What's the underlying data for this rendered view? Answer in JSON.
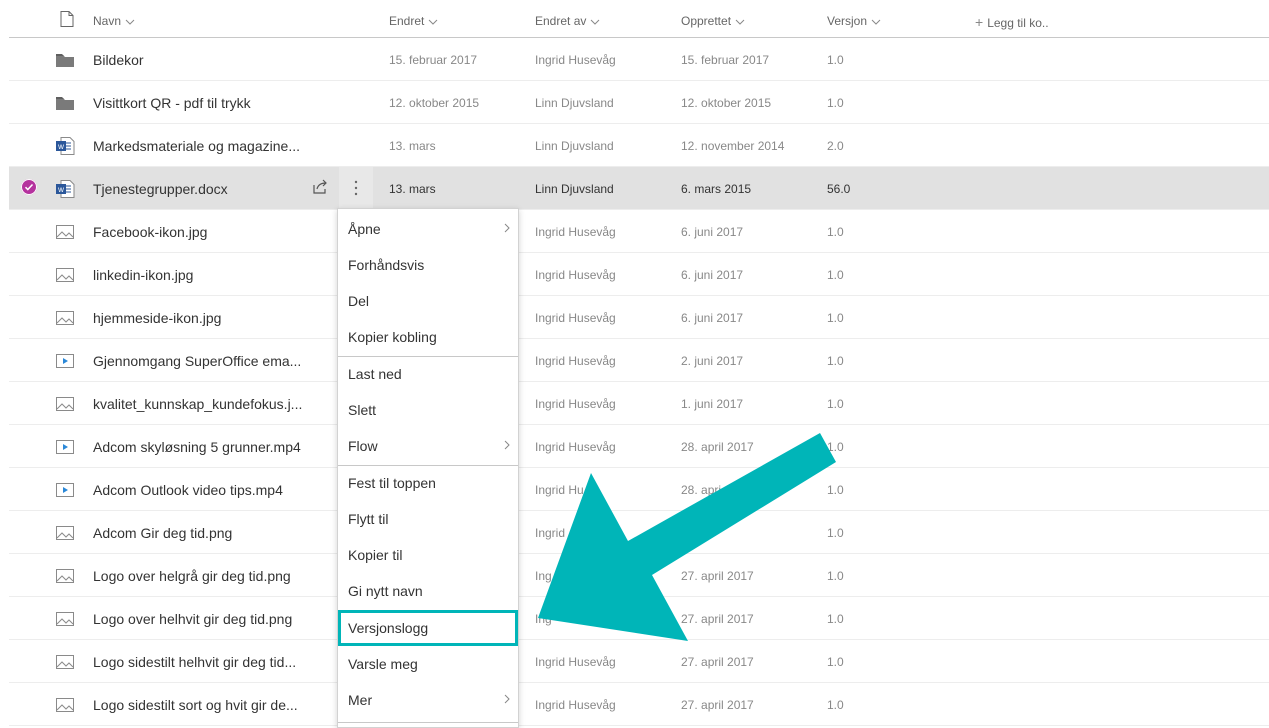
{
  "columns": {
    "name": "Navn",
    "modified": "Endret",
    "modified_by": "Endret av",
    "created": "Opprettet",
    "version": "Versjon",
    "add_column": "Legg til ko.."
  },
  "files": [
    {
      "icon": "folder-icon",
      "name": "Bildekor",
      "modified": "15. februar 2017",
      "modified_by": "Ingrid Husevåg",
      "created": "15. februar 2017",
      "version": "1.0"
    },
    {
      "icon": "folder-icon",
      "name": "Visittkort QR - pdf til trykk",
      "modified": "12. oktober 2015",
      "modified_by": "Linn Djuvsland",
      "created": "12. oktober 2015",
      "version": "1.0"
    },
    {
      "icon": "word-doc-icon",
      "name": "Markedsmateriale og magazine...",
      "modified": "13. mars",
      "modified_by": "Linn Djuvsland",
      "created": "12. november 2014",
      "version": "2.0"
    },
    {
      "icon": "word-doc-icon",
      "name": "Tjenestegrupper.docx",
      "modified": "13. mars",
      "modified_by": "Linn Djuvsland",
      "created": "6. mars 2015",
      "version": "56.0",
      "selected": true
    },
    {
      "icon": "image-icon",
      "name": "Facebook-ikon.jpg",
      "modified": "",
      "modified_by": "Ingrid Husevåg",
      "created": "6. juni 2017",
      "version": "1.0"
    },
    {
      "icon": "image-icon",
      "name": "linkedin-ikon.jpg",
      "modified": "",
      "modified_by": "Ingrid Husevåg",
      "created": "6. juni 2017",
      "version": "1.0"
    },
    {
      "icon": "image-icon",
      "name": "hjemmeside-ikon.jpg",
      "modified": "",
      "modified_by": "Ingrid Husevåg",
      "created": "6. juni 2017",
      "version": "1.0"
    },
    {
      "icon": "video-icon",
      "name": "Gjennomgang SuperOffice ema...",
      "modified": "",
      "modified_by": "Ingrid Husevåg",
      "created": "2. juni 2017",
      "version": "1.0"
    },
    {
      "icon": "image-icon",
      "name": "kvalitet_kunnskap_kundefokus.j...",
      "modified": "",
      "modified_by": "Ingrid Husevåg",
      "created": "1. juni 2017",
      "version": "1.0"
    },
    {
      "icon": "video-icon",
      "name": "Adcom skyløsning 5 grunner.mp4",
      "modified": "",
      "modified_by": "Ingrid Husevåg",
      "created": "28. april 2017",
      "version": "1.0"
    },
    {
      "icon": "video-icon",
      "name": "Adcom Outlook video tips.mp4",
      "modified": "",
      "modified_by": "Ingrid Hu",
      "created": "28. apri",
      "version": "1.0"
    },
    {
      "icon": "image-icon",
      "name": "Adcom Gir deg tid.png",
      "modified": "",
      "modified_by": "Ingrid",
      "created": "2017",
      "version": "1.0"
    },
    {
      "icon": "image-icon",
      "name": "Logo over helgrå gir deg tid.png",
      "modified": "",
      "modified_by": "Ing",
      "created": "27. april 2017",
      "version": "1.0"
    },
    {
      "icon": "image-icon",
      "name": "Logo over helhvit gir deg tid.png",
      "modified": "",
      "modified_by": "Ing",
      "created": "27. april 2017",
      "version": "1.0"
    },
    {
      "icon": "image-icon",
      "name": "Logo sidestilt helhvit gir deg tid...",
      "modified": "",
      "modified_by": "Ingrid Husevåg",
      "created": "27. april 2017",
      "version": "1.0"
    },
    {
      "icon": "image-icon",
      "name": "Logo sidestilt sort og hvit gir de...",
      "modified": "",
      "modified_by": "Ingrid Husevåg",
      "created": "27. april 2017",
      "version": "1.0"
    }
  ],
  "context_menu": [
    {
      "label": "Åpne",
      "submenu": true
    },
    {
      "label": "Forhåndsvis"
    },
    {
      "label": "Del"
    },
    {
      "label": "Kopier kobling"
    },
    {
      "label": "Last ned"
    },
    {
      "label": "Slett"
    },
    {
      "label": "Flow",
      "submenu": true
    },
    {
      "label": "Fest til toppen"
    },
    {
      "label": "Flytt til"
    },
    {
      "label": "Kopier til"
    },
    {
      "label": "Gi nytt navn"
    },
    {
      "label": "Versjonslogg",
      "highlighted": true
    },
    {
      "label": "Varsle meg"
    },
    {
      "label": "Mer",
      "submenu": true
    }
  ],
  "colors": {
    "accent": "#00b5b8",
    "selection_check": "#b5329e",
    "selected_row": "#e1e1e1"
  }
}
